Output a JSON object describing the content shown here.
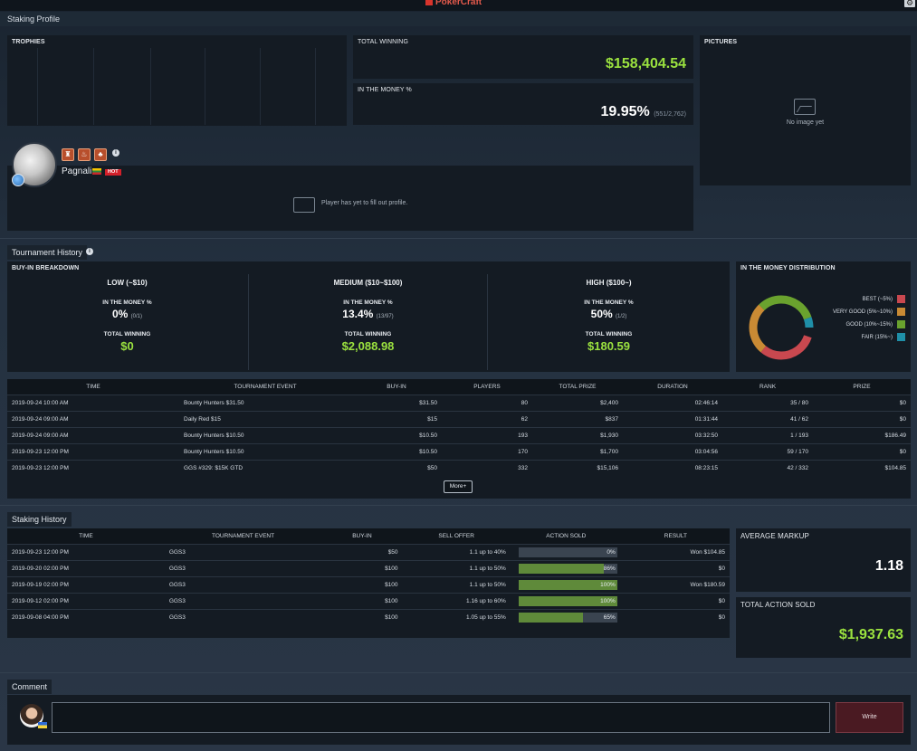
{
  "app": {
    "logo": "PokerCraft",
    "title": "Staking Profile"
  },
  "trophies": {
    "label": "TROPHIES"
  },
  "total_winning": {
    "label": "TOTAL WINNING",
    "value": "$158,404.54"
  },
  "in_the_money": {
    "label": "IN THE MONEY %",
    "value": "19.95%",
    "detail": "(551/2,762)"
  },
  "pictures": {
    "label": "PICTURES",
    "empty_text": "No image yet"
  },
  "profile": {
    "name": "Pagnali",
    "hot_badge": "HOT",
    "empty_text": "Player has yet to fill out profile.",
    "info": "i"
  },
  "tournament_history": {
    "tab": "Tournament History",
    "info": "i",
    "breakdown_label": "BUY-IN BREAKDOWN",
    "levels": [
      {
        "name": "LOW (~$10)",
        "itm_label": "IN THE MONEY %",
        "itm": "0%",
        "itm_detail": "(0/1)",
        "win_label": "TOTAL WINNING",
        "win": "$0"
      },
      {
        "name": "MEDIUM ($10~$100)",
        "itm_label": "IN THE MONEY %",
        "itm": "13.4%",
        "itm_detail": "(13/97)",
        "win_label": "TOTAL WINNING",
        "win": "$2,088.98"
      },
      {
        "name": "HIGH ($100~)",
        "itm_label": "IN THE MONEY %",
        "itm": "50%",
        "itm_detail": "(1/2)",
        "win_label": "TOTAL WINNING",
        "win": "$180.59"
      }
    ],
    "distribution": {
      "label": "IN THE MONEY DISTRIBUTION",
      "legend": [
        {
          "name": "BEST (~5%)",
          "color": "#c9484f"
        },
        {
          "name": "VERY GOOD (5%~10%)",
          "color": "#c98a34"
        },
        {
          "name": "GOOD (10%~15%)",
          "color": "#6aa22e"
        },
        {
          "name": "FAIR (15%~)",
          "color": "#1f8fa8"
        }
      ]
    },
    "columns": [
      "TIME",
      "TOURNAMENT EVENT",
      "BUY-IN",
      "PLAYERS",
      "TOTAL PRIZE",
      "DURATION",
      "RANK",
      "PRIZE"
    ],
    "rows": [
      [
        "2019-09-24 10:00 AM",
        "Bounty Hunters $31.50",
        "$31.50",
        "80",
        "$2,400",
        "02:46:14",
        "35 / 80",
        "$0"
      ],
      [
        "2019-09-24 09:00 AM",
        "Daily Red $15",
        "$15",
        "62",
        "$837",
        "01:31:44",
        "41 / 62",
        "$0"
      ],
      [
        "2019-09-24 09:00 AM",
        "Bounty Hunters $10.50",
        "$10.50",
        "193",
        "$1,930",
        "03:32:50",
        "1 / 193",
        "$186.49"
      ],
      [
        "2019-09-23 12:00 PM",
        "Bounty Hunters $10.50",
        "$10.50",
        "170",
        "$1,700",
        "03:04:56",
        "59 / 170",
        "$0"
      ],
      [
        "2019-09-23 12:00 PM",
        "GGS #329: $15K GTD",
        "$50",
        "332",
        "$15,106",
        "08:23:15",
        "42 / 332",
        "$104.85"
      ]
    ],
    "more_label": "More+"
  },
  "staking_history": {
    "tab": "Staking History",
    "columns": [
      "TIME",
      "TOURNAMENT EVENT",
      "BUY-IN",
      "SELL OFFER",
      "ACTION SOLD",
      "RESULT"
    ],
    "rows": [
      {
        "time": "2019-09-23 12:00 PM",
        "event": "GGS3",
        "buyin": "$50",
        "offer": "1.1 up to 40%",
        "sold_pct": 0,
        "sold": "0%",
        "result": "Won $104.85"
      },
      {
        "time": "2019-09-20 02:00 PM",
        "event": "GGS3",
        "buyin": "$100",
        "offer": "1.1 up to 50%",
        "sold_pct": 86,
        "sold": "86%",
        "result": "$0"
      },
      {
        "time": "2019-09-19 02:00 PM",
        "event": "GGS3",
        "buyin": "$100",
        "offer": "1.1 up to 50%",
        "sold_pct": 100,
        "sold": "100%",
        "result": "Won $180.59"
      },
      {
        "time": "2019-09-12 02:00 PM",
        "event": "GGS3",
        "buyin": "$100",
        "offer": "1.16 up to 60%",
        "sold_pct": 100,
        "sold": "100%",
        "result": "$0"
      },
      {
        "time": "2019-09-08 04:00 PM",
        "event": "GGS3",
        "buyin": "$100",
        "offer": "1.05 up to 55%",
        "sold_pct": 65,
        "sold": "65%",
        "result": "$0"
      }
    ],
    "avg_markup": {
      "label": "AVERAGE MARKUP",
      "value": "1.18"
    },
    "total_action": {
      "label": "TOTAL ACTION SOLD",
      "value": "$1,937.63"
    }
  },
  "comment": {
    "tab": "Comment",
    "input_value": "",
    "write_label": "Write"
  }
}
